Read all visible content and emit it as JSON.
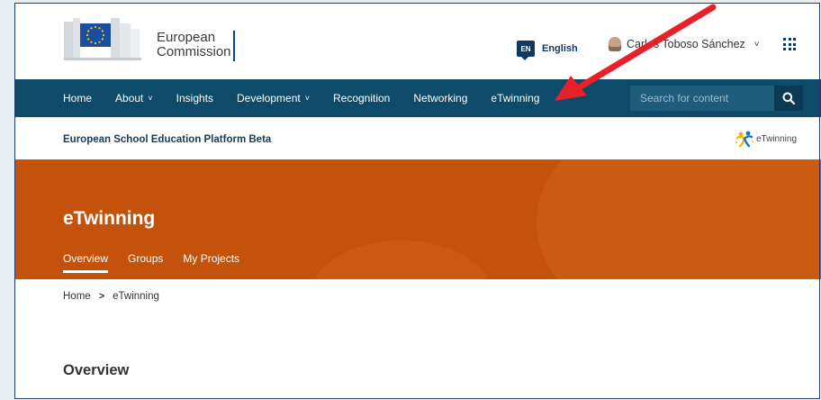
{
  "header": {
    "logo_line1": "European",
    "logo_line2": "Commission",
    "language_code": "EN",
    "language_label": "English",
    "user_name": "Carlos Toboso Sánchez"
  },
  "nav": {
    "items": [
      {
        "label": "Home",
        "dropdown": false
      },
      {
        "label": "About",
        "dropdown": true
      },
      {
        "label": "Insights",
        "dropdown": false
      },
      {
        "label": "Development",
        "dropdown": true
      },
      {
        "label": "Recognition",
        "dropdown": false
      },
      {
        "label": "Networking",
        "dropdown": false
      },
      {
        "label": "eTwinning",
        "dropdown": false
      }
    ],
    "search_placeholder": "Search for content"
  },
  "platform": {
    "title": "European School Education Platform Beta",
    "etwinning_logo_text": "eTwinning"
  },
  "hero": {
    "title": "eTwinning",
    "tabs": [
      {
        "label": "Overview",
        "active": true
      },
      {
        "label": "Groups",
        "active": false
      },
      {
        "label": "My Projects",
        "active": false
      }
    ]
  },
  "breadcrumb": {
    "home": "Home",
    "separator": ">",
    "current": "eTwinning"
  },
  "main": {
    "section_title": "Overview"
  },
  "colors": {
    "nav_bg": "#0e4a69",
    "hero_bg": "#c4520b",
    "annotation_arrow": "#e8202a",
    "page_bg": "#e6eef2"
  }
}
